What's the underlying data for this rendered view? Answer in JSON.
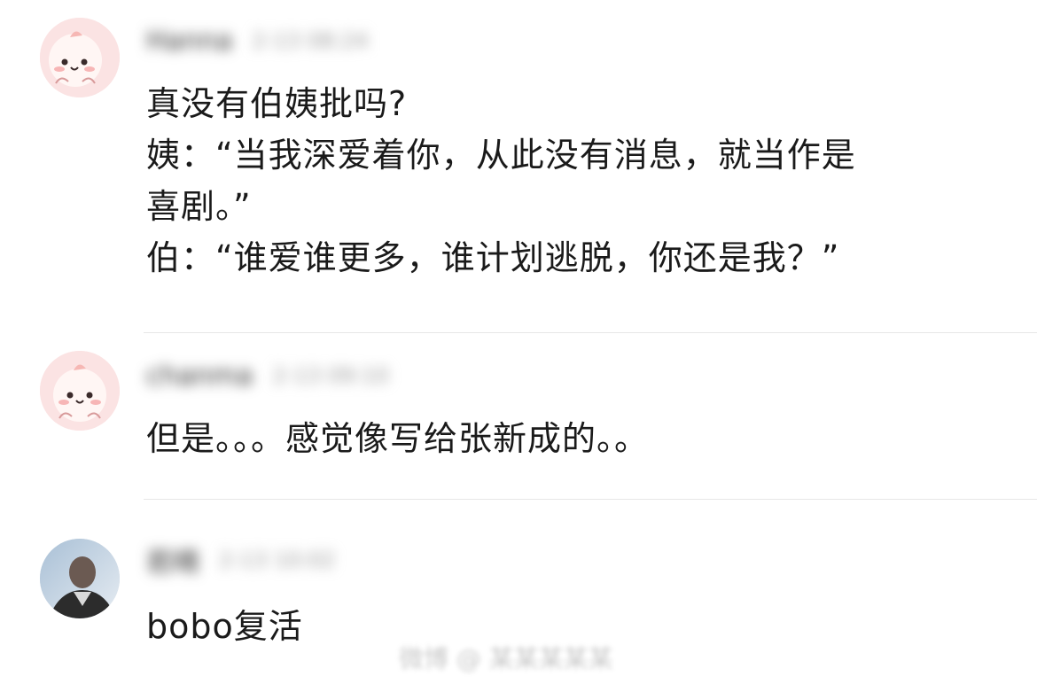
{
  "comments": [
    {
      "username": "Hanna",
      "timestamp": "2-13 08:24",
      "lines": [
        "真没有伯姨批吗?",
        "姨：“当我深爱着你，从此没有消息，就当作是",
        "喜剧。”",
        "伯：“谁爱谁更多，谁计划逃脱，你还是我？”"
      ],
      "avatar_icon": "pink-cartoon-avatar-icon"
    },
    {
      "username": "chanma",
      "timestamp": "2-13 09:10",
      "lines": [
        "但是。。。感觉像写给张新成的。。"
      ],
      "avatar_icon": "pink-cartoon-avatar-icon"
    },
    {
      "username": "若晴",
      "timestamp": "2-13 10:02",
      "lines": [
        "bobo复活"
      ],
      "avatar_icon": "photo-avatar-icon"
    }
  ],
  "watermark": {
    "text": "微博 @ 某某某某某"
  },
  "colors": {
    "text": "#1a1a1a",
    "divider": "#e6e6e6",
    "avatar_pink": "#fbe3e3"
  }
}
